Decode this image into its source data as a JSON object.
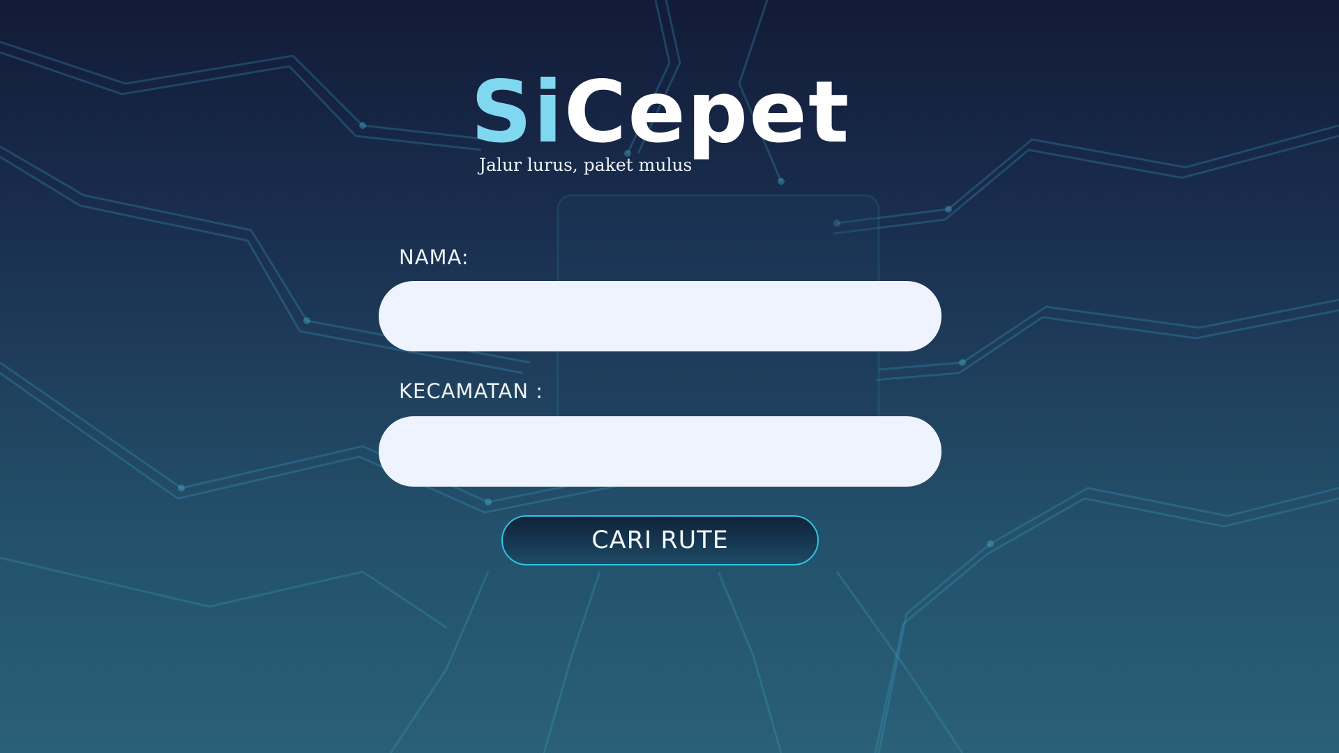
{
  "brand": {
    "logo_part1": "Si",
    "logo_part2": "Cepet",
    "tagline": "Jalur lurus, paket mulus",
    "accent_color": "#7fd8f0"
  },
  "form": {
    "nama_label": "NAMA:",
    "nama_value": "",
    "kecamatan_label": "KECAMATAN :",
    "kecamatan_value": "",
    "submit_label": "CARI RUTE",
    "button_border_color": "#2fc4e4"
  }
}
